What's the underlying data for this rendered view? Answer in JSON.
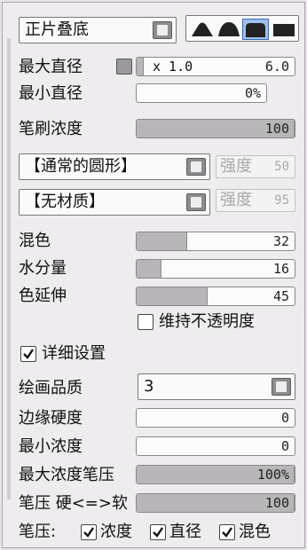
{
  "blend_mode": {
    "value": "正片叠底"
  },
  "shape_buttons": [
    "hard-peak-shape",
    "soft-dome-shape",
    "rounded-shape",
    "flat-shape"
  ],
  "max_diameter": {
    "label": "最大直径",
    "multiplier": "x 1.0",
    "value": "6.0"
  },
  "min_diameter": {
    "label": "最小直径",
    "value": "0%"
  },
  "brush_density": {
    "label": "笔刷浓度",
    "value": "100",
    "fraction": 1.0
  },
  "tip_shape": {
    "value": "【通常的圆形】",
    "strength_label": "强度",
    "strength_value": "50"
  },
  "texture": {
    "value": "【无材质】",
    "strength_label": "强度",
    "strength_value": "95"
  },
  "mixing": {
    "label": "混色",
    "value": "32",
    "fraction": 0.32
  },
  "water": {
    "label": "水分量",
    "value": "16",
    "fraction": 0.16
  },
  "color_stretch": {
    "label": "色延伸",
    "value": "45",
    "fraction": 0.45
  },
  "keep_opacity": {
    "label": "维持不透明度",
    "checked": false
  },
  "detail_settings": {
    "label": "详细设置",
    "checked": true
  },
  "render_quality": {
    "label": "绘画品质",
    "value": "3"
  },
  "edge_hardness": {
    "label": "边缘硬度",
    "value": "0",
    "fraction": 0.0
  },
  "min_density": {
    "label": "最小浓度",
    "value": "0",
    "fraction": 0.0
  },
  "max_density_pressure": {
    "label": "最大浓度笔压",
    "value": "100%",
    "fraction": 1.0
  },
  "pressure_hardness": {
    "label": "笔压 硬<=>软",
    "value": "100",
    "fraction": 1.0
  },
  "pressure_row": {
    "label": "笔压:",
    "density": {
      "label": "浓度",
      "checked": true
    },
    "diameter": {
      "label": "直径",
      "checked": true
    },
    "blend": {
      "label": "混色",
      "checked": true
    }
  },
  "colors": {
    "fill": "#b8b6b8",
    "panel": "#eeecee",
    "button": "#8d8b8f"
  }
}
